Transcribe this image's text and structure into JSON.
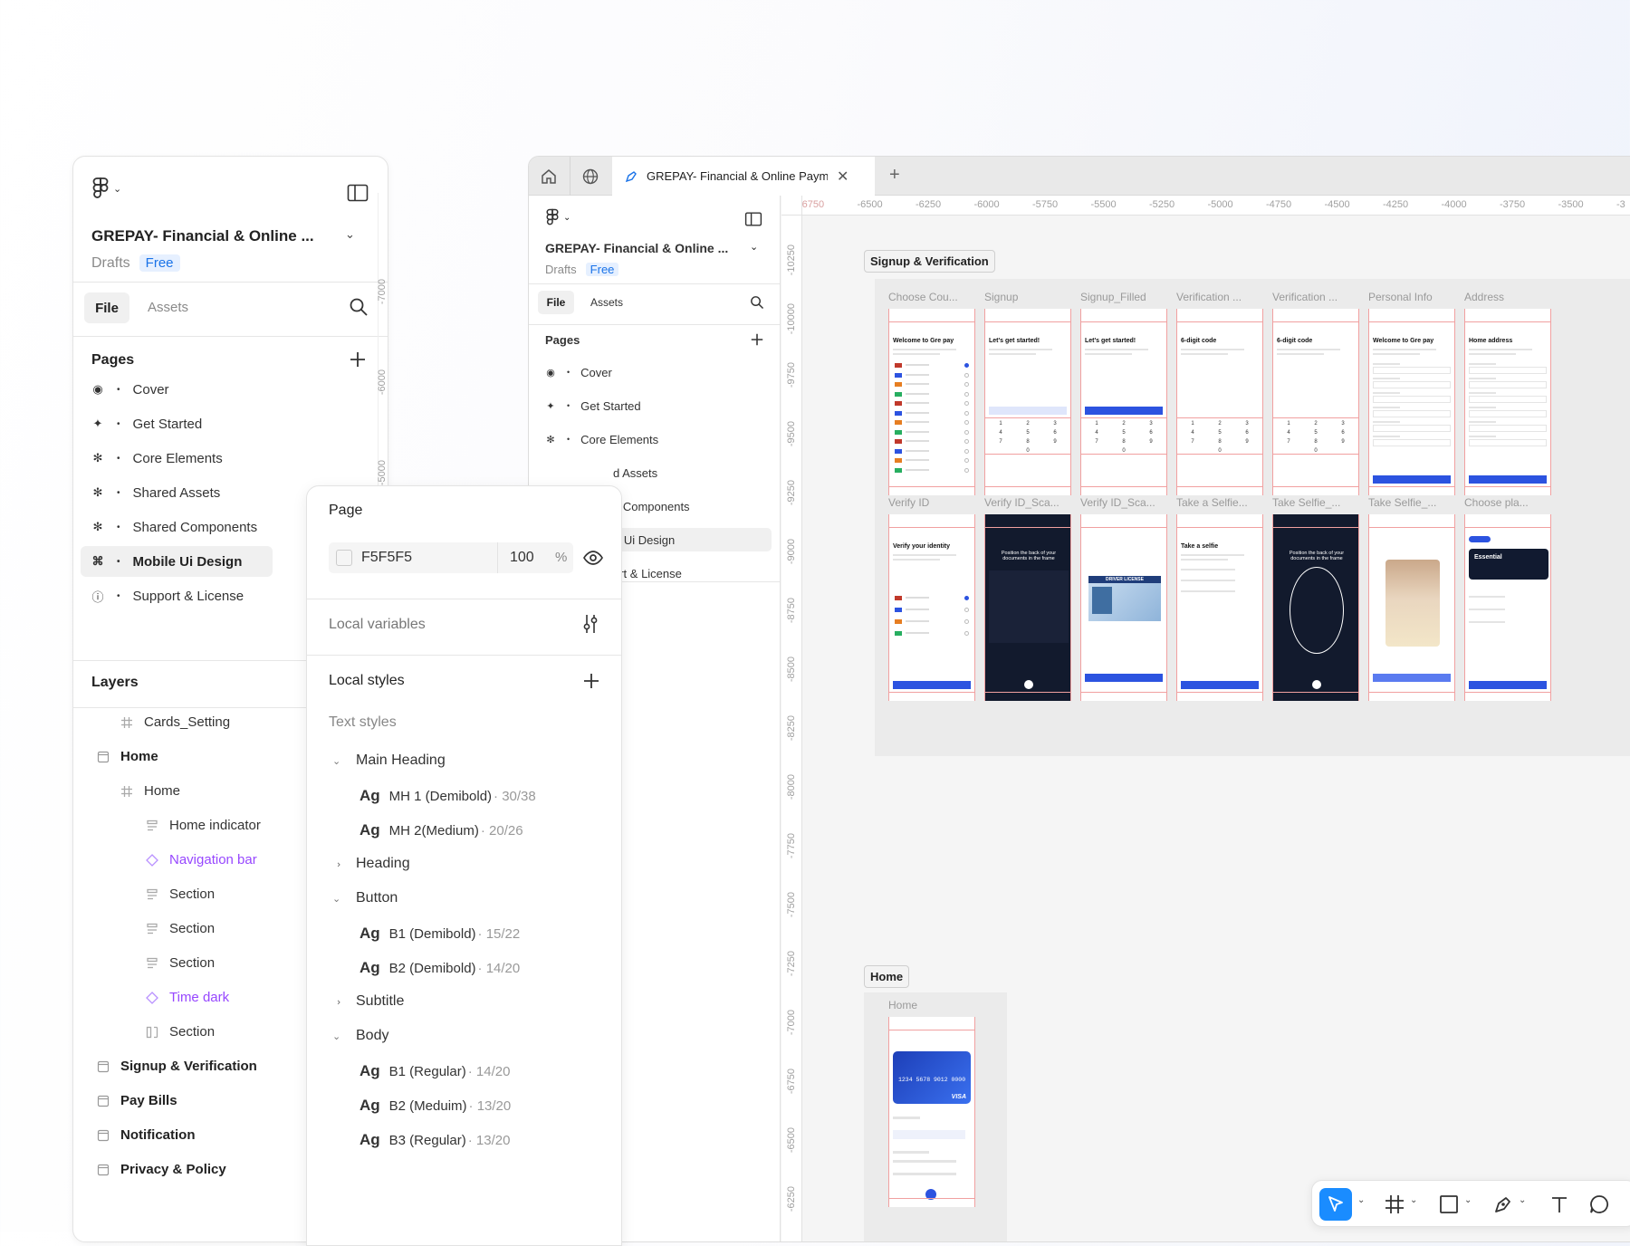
{
  "left_panel": {
    "file_title": "GREPAY- Financial & Online ...",
    "drafts": "Drafts",
    "plan": "Free",
    "tab_file": "File",
    "tab_assets": "Assets",
    "pages_header": "Pages",
    "pages": [
      {
        "icon": "◉",
        "label": "Cover"
      },
      {
        "icon": "✦",
        "label": "Get Started"
      },
      {
        "icon": "✻",
        "label": "Core Elements"
      },
      {
        "icon": "✻",
        "label": "Shared Assets"
      },
      {
        "icon": "✻",
        "label": "Shared Components"
      },
      {
        "icon": "⌘",
        "label": "Mobile Ui Design"
      },
      {
        "icon": "ⓘ",
        "label": "Support & License"
      }
    ],
    "layers_header": "Layers",
    "layers": [
      {
        "label": "Cards_Setting"
      },
      {
        "label": "Home"
      },
      {
        "label": "Home"
      },
      {
        "label": "Home indicator"
      },
      {
        "label": "Navigation bar"
      },
      {
        "label": "Section"
      },
      {
        "label": "Section"
      },
      {
        "label": "Section"
      },
      {
        "label": "Time dark"
      },
      {
        "label": "Section"
      },
      {
        "label": "Signup & Verification"
      },
      {
        "label": "Pay Bills"
      },
      {
        "label": "Notification"
      },
      {
        "label": "Privacy & Policy"
      }
    ],
    "ruler_marks": [
      "-7000",
      "-6000",
      "-5000"
    ]
  },
  "props_panel": {
    "page_header": "Page",
    "bg_color_value": "F5F5F5",
    "opacity_value": "100",
    "opacity_unit": "%",
    "local_variables": "Local variables",
    "local_styles": "Local styles",
    "text_styles": "Text styles",
    "ag": "Ag",
    "groups": [
      {
        "label": "Main Heading",
        "expanded": true,
        "items": [
          {
            "name": "MH 1 (Demibold)",
            "spec": " · 30/38"
          },
          {
            "name": "MH 2(Medium)",
            "spec": " · 20/26"
          }
        ]
      },
      {
        "label": "Heading",
        "expanded": false,
        "items": []
      },
      {
        "label": "Button",
        "expanded": true,
        "items": [
          {
            "name": "B1 (Demibold)",
            "spec": " · 15/22"
          },
          {
            "name": "B2 (Demibold)",
            "spec": " · 14/20"
          }
        ]
      },
      {
        "label": "Subtitle",
        "expanded": false,
        "items": []
      },
      {
        "label": "Body",
        "expanded": true,
        "items": [
          {
            "name": "B1 (Regular)",
            "spec": " · 14/20"
          },
          {
            "name": "B2 (Meduim)",
            "spec": " · 13/20"
          },
          {
            "name": "B3 (Regular)",
            "spec": " · 13/20"
          }
        ]
      }
    ]
  },
  "browser": {
    "tab_title": "GREPAY- Financial & Online Paym",
    "panel": {
      "file_title": "GREPAY- Financial & Online ...",
      "drafts": "Drafts",
      "plan": "Free",
      "tab_file": "File",
      "tab_assets": "Assets",
      "pages_header": "Pages",
      "pages": [
        {
          "icon": "◉",
          "label": "Cover"
        },
        {
          "icon": "✦",
          "label": "Get Started"
        },
        {
          "icon": "✻",
          "label": "Core Elements"
        },
        {
          "icon": "",
          "label": "d Assets"
        },
        {
          "icon": "",
          "label": "d Components"
        },
        {
          "icon": "",
          "label": "e Ui Design"
        },
        {
          "icon": "",
          "label": "ort & License"
        }
      ]
    },
    "ruler_top": [
      "-6750",
      "-6500",
      "-6250",
      "-6000",
      "-5750",
      "-5500",
      "-5250",
      "-5000",
      "-4750",
      "-4500",
      "-4250",
      "-4000",
      "-3750",
      "-3500",
      "-3"
    ],
    "ruler_left": [
      "-10250",
      "-10000",
      "-9750",
      "-9500",
      "-9250",
      "-9000",
      "-8750",
      "-8500",
      "-8250",
      "-8000",
      "-7750",
      "-7500",
      "-7250",
      "-7000",
      "-6750",
      "-6500",
      "-6250"
    ],
    "section1": {
      "label": "Signup & Verification",
      "row1": [
        {
          "title": "Choose Cou...",
          "heading": "Welcome to Gre pay",
          "kind": "list"
        },
        {
          "title": "Signup",
          "heading": "Let's get started!",
          "kind": "keypad"
        },
        {
          "title": "Signup_Filled",
          "heading": "Let's get started!",
          "kind": "keypad-btn"
        },
        {
          "title": "Verification ...",
          "heading": "6-digit code",
          "kind": "keypad"
        },
        {
          "title": "Verification ...",
          "heading": "6-digit code",
          "kind": "keypad"
        },
        {
          "title": "Personal Info",
          "heading": "Welcome to Gre pay",
          "kind": "form"
        },
        {
          "title": "Address",
          "heading": "Home address",
          "kind": "form"
        }
      ],
      "row2": [
        {
          "title": "Verify ID",
          "heading": "Verify your identity",
          "kind": "verify"
        },
        {
          "title": "Verify ID_Sca...",
          "heading": "Position the back of your documents in the frame",
          "kind": "dark"
        },
        {
          "title": "Verify ID_Sca...",
          "heading": "DRIVER LICENSE",
          "kind": "license"
        },
        {
          "title": "Take a Selfie...",
          "heading": "Take a selfie",
          "kind": "selfie"
        },
        {
          "title": "Take Selfie_...",
          "heading": "Position the back of your documents in the frame",
          "kind": "dark-oval"
        },
        {
          "title": "Take Selfie_...",
          "heading": "",
          "kind": "photo"
        },
        {
          "title": "Choose pla...",
          "heading": "Essential",
          "kind": "plan"
        }
      ]
    },
    "section2": {
      "label": "Home",
      "frame_title": "Home",
      "card_number": "1234 5678 9012 0000",
      "card_brand": "VISA"
    }
  },
  "toolbar": {
    "tools": [
      "move",
      "frame",
      "shape",
      "pen",
      "text",
      "comment"
    ]
  },
  "colors": {
    "accent": "#2c53e0",
    "selected_tool": "#1a8cff",
    "component_purple": "#9747ff",
    "guide_red": "#f1a0a0"
  }
}
